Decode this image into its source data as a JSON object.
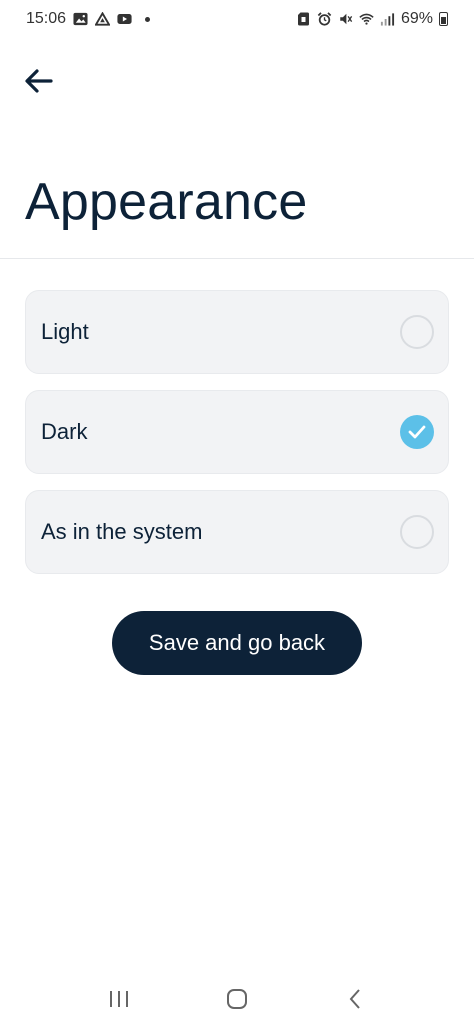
{
  "status_bar": {
    "time": "15:06",
    "battery": "69%"
  },
  "header": {
    "title": "Appearance"
  },
  "options": [
    {
      "label": "Light",
      "selected": false
    },
    {
      "label": "Dark",
      "selected": true
    },
    {
      "label": "As in the system",
      "selected": false
    }
  ],
  "save_button": {
    "label": "Save and go back"
  },
  "colors": {
    "primary": "#0d2238",
    "accent": "#5cc0e8",
    "option_bg": "#f2f3f5"
  }
}
